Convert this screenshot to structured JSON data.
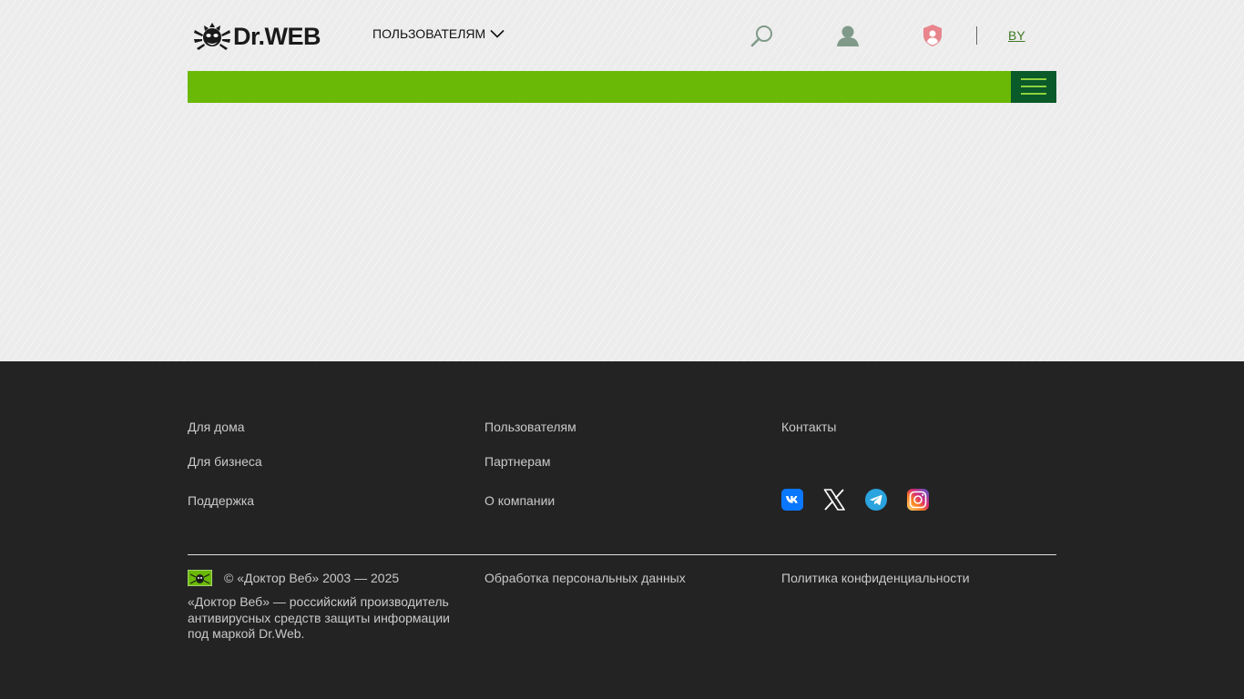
{
  "header": {
    "logo_text": "Dr.WEB",
    "users_menu_label": "ПОЛЬЗОВАТЕЛЯМ",
    "region_label": "BY",
    "icons": [
      "search-icon",
      "user-icon",
      "shield-user-icon",
      "menu-icon"
    ]
  },
  "colors": {
    "accent_green": "#6ab906",
    "dark_green": "#0b5a2a",
    "footer_bg": "#232323",
    "region_link": "#3d7a26"
  },
  "footer": {
    "columns": [
      [
        "Для дома",
        "Для бизнеса",
        "Поддержка"
      ],
      [
        "Пользователям",
        "Партнерам",
        "О компании"
      ],
      [
        "Контакты"
      ]
    ],
    "social": [
      "vk-icon",
      "x-icon",
      "telegram-icon",
      "instagram-icon"
    ],
    "copyright": "© «Доктор Веб» 2003 — 2025",
    "about": "«Доктор Веб» — российский производитель антивирусных средств защиты информации под маркой Dr.Web.",
    "personal_data_link": "Обработка персональных данных",
    "privacy_link": "Политика конфиденциальности"
  }
}
